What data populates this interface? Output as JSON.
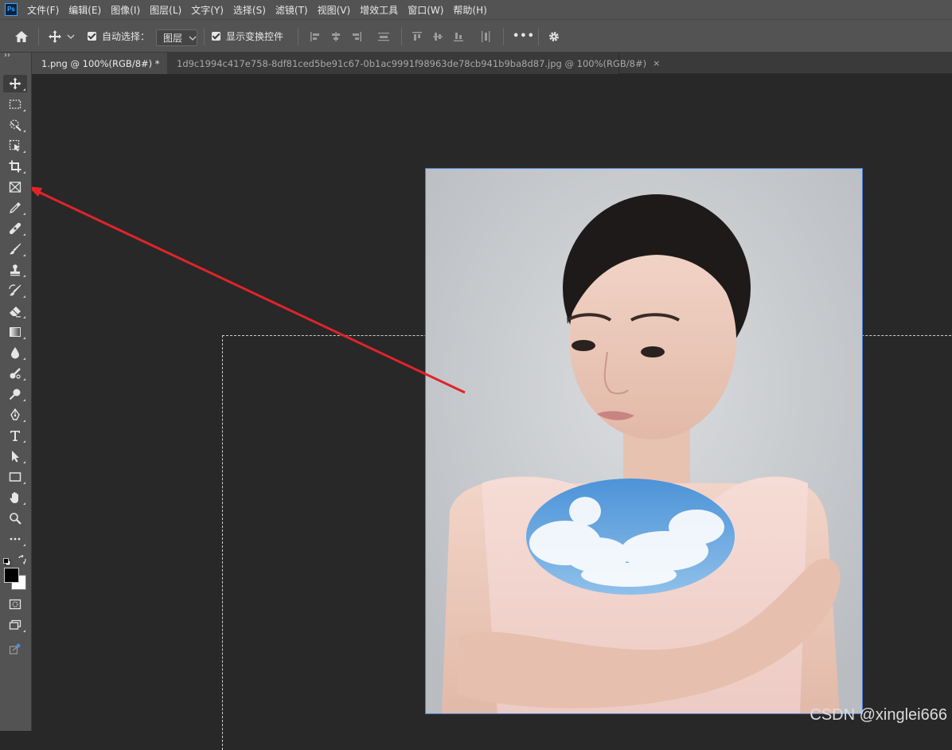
{
  "app": {
    "logo_text": "Ps"
  },
  "menu": [
    "文件(F)",
    "编辑(E)",
    "图像(I)",
    "图层(L)",
    "文字(Y)",
    "选择(S)",
    "滤镜(T)",
    "视图(V)",
    "增效工具",
    "窗口(W)",
    "帮助(H)"
  ],
  "options": {
    "auto_select_label": "自动选择：",
    "auto_select_checked": true,
    "layer_select_value": "图层",
    "show_transform_label": "显示变换控件",
    "show_transform_checked": true,
    "more_label": "•••"
  },
  "tabs": [
    {
      "label": "1.png @ 100%(RGB/8#) *",
      "active": true,
      "close": "×"
    },
    {
      "label": "1d9c1994c417e758-8df81ced5be91c67-0b1ac9991f98963de78cb941b9ba8d87.jpg @ 100%(RGB/8#)",
      "active": false,
      "close": "×"
    }
  ],
  "toolbar": {
    "collapse_glyph": "››",
    "tools": [
      "move-tool",
      "rectangular-marquee-tool",
      "object-selection-tool",
      "crop-select-tool",
      "crop-tool",
      "frame-tool",
      "eyedropper-tool",
      "healing-brush-tool",
      "brush-tool",
      "clone-stamp-tool",
      "history-brush-tool",
      "eraser-tool",
      "gradient-tool",
      "blur-tool",
      "dodge-tool",
      "burn-tool",
      "pen-tool",
      "type-tool",
      "path-selection-tool",
      "rectangle-tool",
      "hand-tool",
      "zoom-tool",
      "more-tools"
    ],
    "foreground_color": "#000000",
    "background_color": "#ffffff"
  },
  "canvas": {
    "watermark": "CSDN @xinglei666",
    "annotation_arrow_color": "#e0242a"
  }
}
